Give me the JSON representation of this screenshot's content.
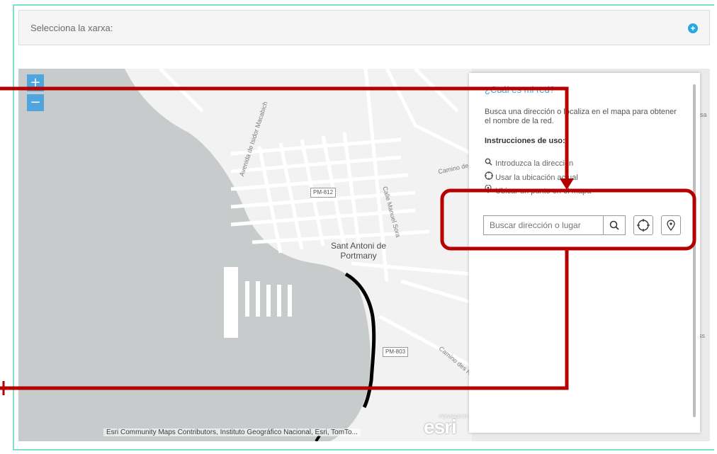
{
  "network_selector": {
    "label": "Selecciona la xarxa:",
    "add_icon": "plus-circle-icon"
  },
  "map": {
    "zoom_in_label": "+",
    "zoom_out_label": "−",
    "city_label": "Sant Antoni de Portmany",
    "roads": {
      "isidor": "Avenida de Isidor Macabich",
      "manuel": "Calle Manuel Sora",
      "camino_top": "Camino de",
      "camino_bottom": "Camino des Re",
      "edge_sa": "sa",
      "edge_iss": "iss"
    },
    "shields": {
      "pm812": "PM-812",
      "pm803": "PM-803"
    },
    "attribution": "Esri Community Maps Contributors, Instituto Geográfico Nacional, Esri, TomTo...",
    "logo_powered": "POWERED BY",
    "logo": "esri"
  },
  "panel": {
    "title": "¿Cuál es mi red?",
    "description": "Busca una dirección o localiza en el mapa para obtener el nombre de la red.",
    "instructions_title": "Instrucciones de uso:",
    "instructions": [
      {
        "icon": "search-icon",
        "text": "Introduzca la dirección"
      },
      {
        "icon": "crosshair-icon",
        "text": "Usar la ubicación actual"
      },
      {
        "icon": "pin-icon",
        "text": "Ubicar un punto en el mapa"
      }
    ],
    "search": {
      "placeholder": "Buscar dirección o lugar"
    }
  },
  "colors": {
    "annotation": "#b50000",
    "accent": "#4a9fd8",
    "frame": "#7ee0c8",
    "zoom": "#4fa5dd"
  }
}
